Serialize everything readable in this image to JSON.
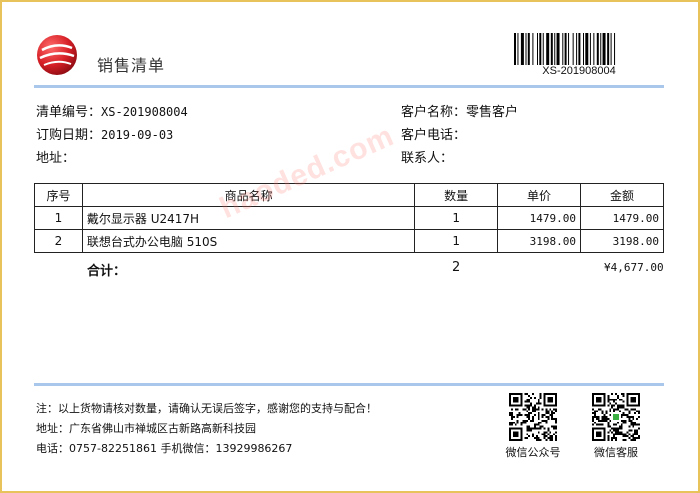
{
  "header": {
    "title": "销售清单",
    "barcode_text": "XS-201908004"
  },
  "order": {
    "number_label": "清单编号：",
    "number": "XS-201908004",
    "date_label": "订购日期：",
    "date": "2019-09-03",
    "address_label": "地址："
  },
  "customer": {
    "name_label": "客户名称：",
    "name": "零售客户",
    "phone_label": "客户电话：",
    "contact_label": "联系人："
  },
  "watermark": "haoded.com",
  "table": {
    "headers": [
      "序号",
      "商品名称",
      "数量",
      "单价",
      "金额"
    ],
    "rows": [
      {
        "no": "1",
        "name": "戴尔显示器 U2417H",
        "qty": "1",
        "price": "1479.00",
        "amount": "1479.00"
      },
      {
        "no": "2",
        "name": "联想台式办公电脑 510S",
        "qty": "1",
        "price": "3198.00",
        "amount": "3198.00"
      }
    ],
    "total_label": "合计：",
    "total_qty": "2",
    "total_amount": "¥4,677.00"
  },
  "footer": {
    "note": "注：以上货物请核对数量，请确认无误后签字，感谢您的支持与配合！",
    "address": "地址：广东省佛山市禅城区古新路高新科技园",
    "contact": "电话：0757-82251861  手机微信：13929986267"
  },
  "qr": {
    "public_label": "微信公众号",
    "service_label": "微信客服"
  },
  "colors": {
    "frame": "#e8c25a",
    "rule": "#a8c7ea",
    "logo": "#d61f26"
  }
}
